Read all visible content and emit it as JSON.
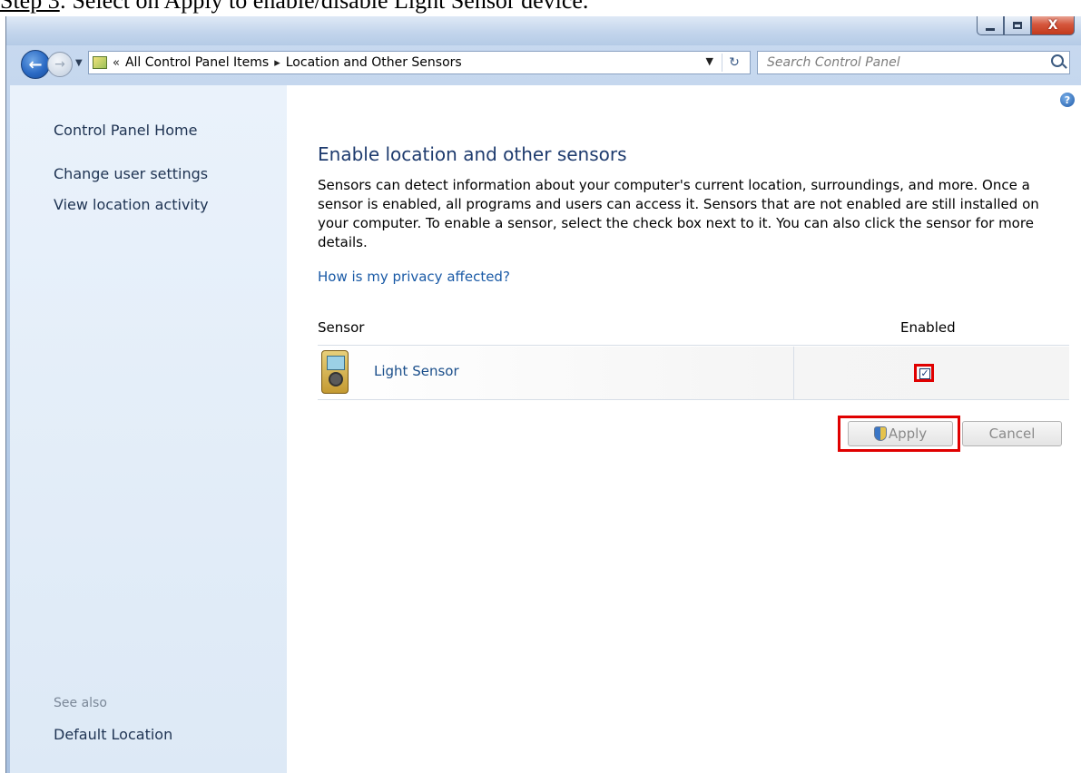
{
  "caption": {
    "step": "Step 3",
    "text": ": Select on Apply to enable/disable Light Sensor device."
  },
  "window": {
    "controls": {
      "minimize": "minimize",
      "maximize": "maximize",
      "close": "X"
    }
  },
  "navigation": {
    "breadcrumb": [
      "All Control Panel Items",
      "Location and Other Sensors"
    ],
    "overflow": "«",
    "search_placeholder": "Search Control Panel"
  },
  "sidebar": {
    "links": [
      "Control Panel Home",
      "Change user settings",
      "View location activity"
    ],
    "see_also_label": "See also",
    "see_also_links": [
      "Default Location"
    ]
  },
  "main": {
    "heading": "Enable location and other sensors",
    "description": "Sensors can detect information about your computer's current location, surroundings, and more. Once a sensor is enabled, all programs and users can access it. Sensors that are not enabled are still installed on your computer. To enable a sensor, select the check box next to it. You can also click the sensor for more details.",
    "privacy_link": "How is my privacy affected?",
    "table": {
      "headers": {
        "sensor": "Sensor",
        "enabled": "Enabled"
      },
      "rows": [
        {
          "name": "Light Sensor",
          "enabled": true,
          "checkbox_glyph": "✓"
        }
      ]
    },
    "buttons": {
      "apply": "Apply",
      "cancel": "Cancel"
    },
    "help_glyph": "?"
  },
  "colors": {
    "highlight": "#e00000",
    "link": "#1a5aa6",
    "heading": "#1e3b6e"
  }
}
